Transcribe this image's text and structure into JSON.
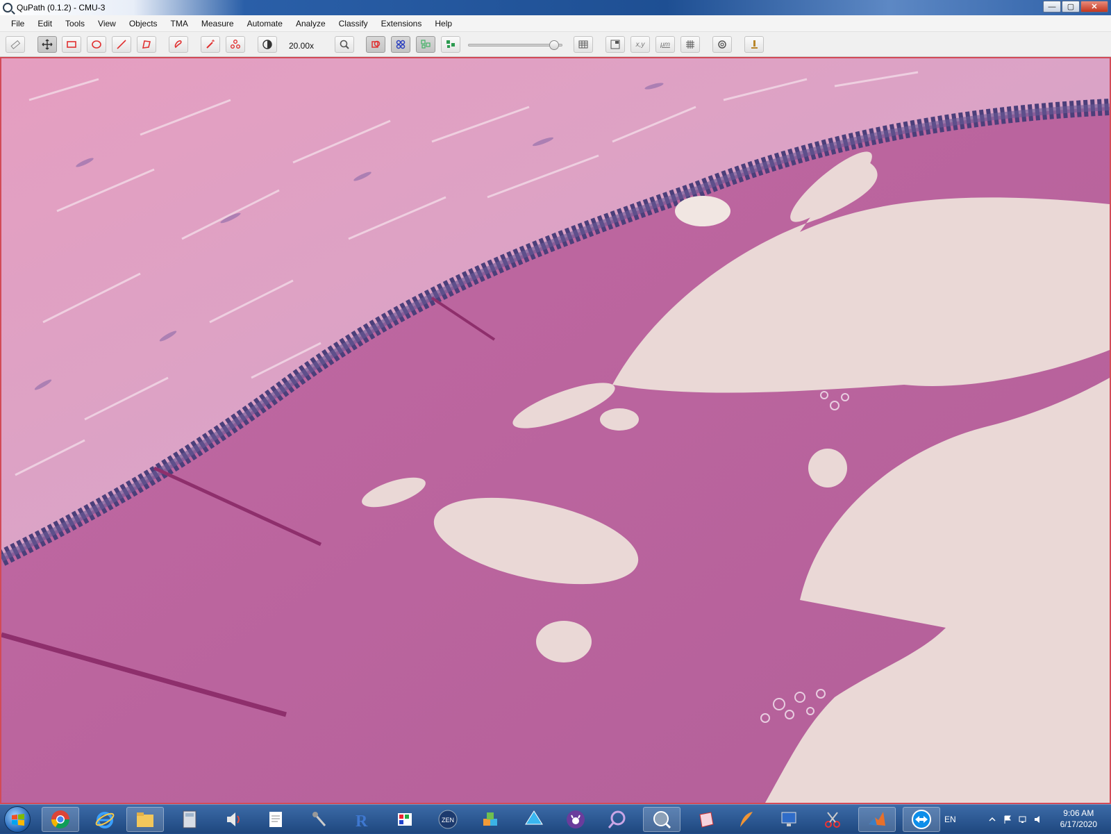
{
  "window": {
    "title": "QuPath (0.1.2) - CMU-3",
    "minimize_label": "—",
    "maximize_label": "▢",
    "close_label": "✕"
  },
  "menu": [
    "File",
    "Edit",
    "Tools",
    "View",
    "Objects",
    "TMA",
    "Measure",
    "Automate",
    "Analyze",
    "Classify",
    "Extensions",
    "Help"
  ],
  "toolbar": {
    "zoom": "20.00x",
    "selected_tool": "move",
    "tools": [
      "measure-tool",
      "move-tool",
      "rectangle-tool",
      "ellipse-tool",
      "line-tool",
      "polygon-tool",
      "brush-tool",
      "wand-tool",
      "points-tool",
      "brightness-contrast",
      "zoom-to-fit",
      "show-annotations",
      "show-tma-grid",
      "show-detections",
      "fill-detections",
      "opacity-slider",
      "show-measurements",
      "show-overview",
      "show-cursor-location",
      "show-scalebar",
      "show-grid",
      "preferences",
      "analysis-pane"
    ],
    "opacity_fraction": 0.95,
    "coordinates_label": "x,y",
    "scalebar_label": "μm",
    "accent_color": "#e03030"
  },
  "taskbar": {
    "apps": [
      "chrome",
      "internet-explorer",
      "file-explorer",
      "calculator",
      "volume-mixer",
      "notepad",
      "microphone",
      "r-language",
      "paint",
      "zen",
      "cubes-app",
      "delta-app",
      "cat-app",
      "qupath-lens",
      "qupath",
      "tissue-viewer",
      "edit-app",
      "remote-desktop",
      "snipping-tool",
      "matlab",
      "teamviewer"
    ],
    "language": "EN",
    "time": "9:06 AM",
    "date": "6/17/2020"
  }
}
